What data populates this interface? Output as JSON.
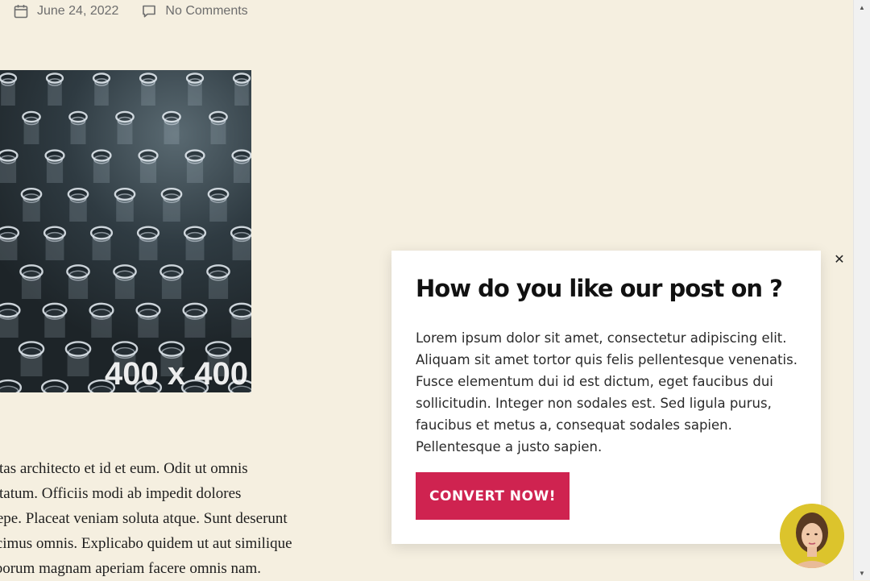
{
  "meta": {
    "date": "June 24, 2022",
    "comments": "No Comments"
  },
  "featured_image": {
    "placeholder_label": "400 x 400"
  },
  "article": {
    "lines": [
      "uptas architecto et id et eum. Odit ut omnis",
      "uptatum. Officiis modi ab impedit dolores",
      "saepe. Placeat veniam soluta atque. Sunt deserunt",
      "lucimus omnis. Explicabo quidem ut aut similique",
      "laborum magnam aperiam facere omnis nam."
    ]
  },
  "popup": {
    "title": "How do you like our post on ?",
    "body": "Lorem ipsum dolor sit amet, consectetur adipiscing elit. Aliquam sit amet tortor quis felis pellentesque venenatis. Fusce elementum dui id est dictum, eget faucibus dui sollicitudin. Integer non sodales est. Sed ligula purus, faucibus et metus a, consequat sodales sapien. Pellentesque a justo sapien.",
    "button_label": "CONVERT NOW!",
    "close_icon": "close-icon"
  },
  "colors": {
    "page_background": "#f5efe0",
    "button": "#cf2350"
  }
}
